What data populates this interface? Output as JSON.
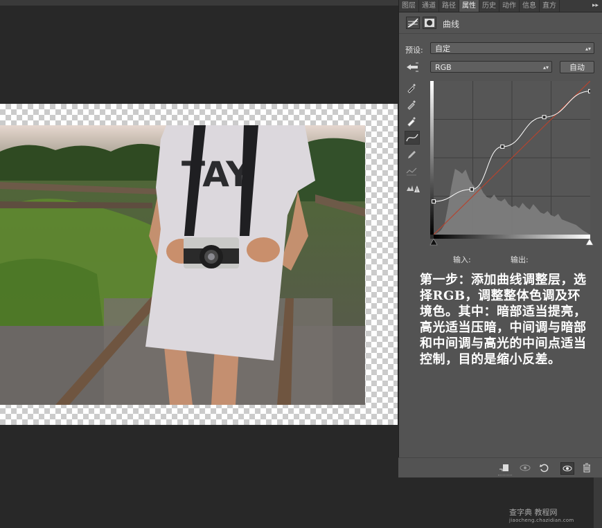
{
  "panel": {
    "tabs": [
      "图层",
      "通道",
      "路径",
      "属性",
      "历史",
      "动作",
      "信息",
      "直方"
    ],
    "active_tab": "属性",
    "menu_glyph": "▸▸",
    "header_title": "曲线",
    "preset_label": "预设:",
    "preset_value": "自定",
    "channel_value": "RGB",
    "auto_button": "自动",
    "input_label": "输入:",
    "output_label": "输出:"
  },
  "curve": {
    "points": [
      [
        0,
        55
      ],
      [
        62,
        75
      ],
      [
        112,
        146
      ],
      [
        180,
        195
      ],
      [
        255,
        238
      ]
    ]
  },
  "instruction_text": "第一步：添加曲线调整层，选择RGB，调整整体色调及环境色。其中：暗部适当提亮，高光适当压暗，中间调与暗部和中间调与高光的中间点适当控制，目的是缩小反差。",
  "photo": {
    "shirt_text": "TAY"
  },
  "watermark": {
    "line1": "查字典 教程网",
    "line2": "jiaocheng.chazidian.com"
  },
  "colors": {
    "panel_bg": "#535353",
    "workspace_bg": "#282828",
    "curve_line": "#ffffff",
    "diagonal_line": "#b5442f"
  },
  "icons": [
    "curves-icon",
    "mask-icon",
    "hand-adjust-icon",
    "eyedropper-black-icon",
    "eyedropper-gray-icon",
    "eyedropper-white-icon",
    "curve-point-tool-icon",
    "pencil-icon",
    "smooth-icon",
    "clipping-warning-icon",
    "clip-to-layer-icon",
    "visibility-toggle-icon",
    "reset-icon",
    "eye-icon",
    "trash-icon"
  ]
}
